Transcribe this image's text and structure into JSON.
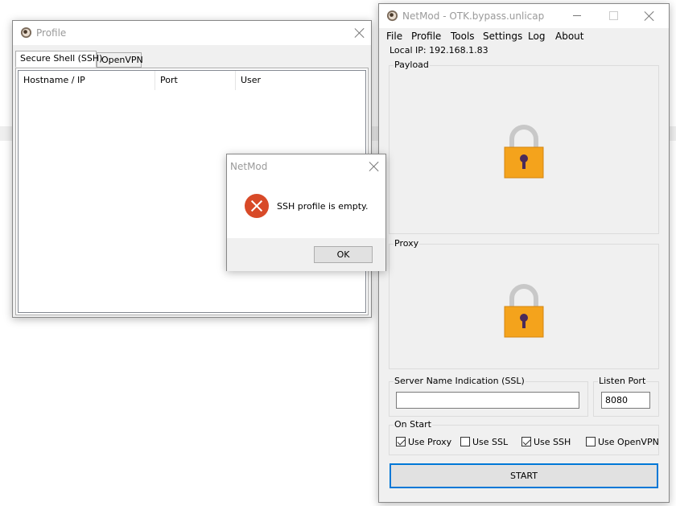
{
  "profile_window": {
    "title": "Profile",
    "tabs": [
      {
        "label": "Secure Shell (SSH)",
        "active": true
      },
      {
        "label": "OpenVPN",
        "active": false
      }
    ],
    "columns": [
      "Hostname / IP",
      "Port",
      "User"
    ]
  },
  "main_window": {
    "title": "NetMod - OTK.bypass.unlicap",
    "menu": [
      "File",
      "Profile",
      "Tools",
      "Settings",
      "Log",
      "About"
    ],
    "local_ip_label": "Local IP: 192.168.1.83",
    "payload_label": "Payload",
    "proxy_label": "Proxy",
    "sni_label": "Server Name Indication (SSL)",
    "sni_value": "",
    "listen_port_label": "Listen Port",
    "listen_port_value": "8080",
    "on_start_label": "On Start",
    "options": [
      {
        "label": "Use Proxy",
        "checked": true
      },
      {
        "label": "Use SSL",
        "checked": false
      },
      {
        "label": "Use SSH",
        "checked": true
      },
      {
        "label": "Use OpenVPN",
        "checked": false
      }
    ],
    "start_label": "START"
  },
  "message_box": {
    "title": "NetMod",
    "message": "SSH profile is empty.",
    "ok_label": "OK"
  },
  "colors": {
    "lock_body": "#f4a31c",
    "lock_shackle": "#c8c8c8",
    "error_icon": "#d84a28",
    "focus_border": "#0078d7"
  }
}
